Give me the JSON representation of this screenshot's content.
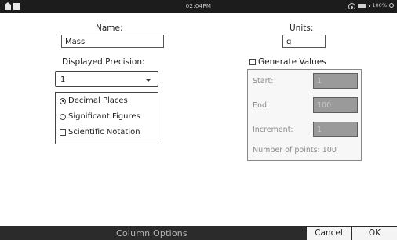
{
  "status": {
    "time": "02:04PM",
    "battery": "100%"
  },
  "name": {
    "label": "Name:",
    "value": "Mass"
  },
  "units": {
    "label": "Units:",
    "value": "g"
  },
  "precision": {
    "label": "Displayed Precision:",
    "value": "1",
    "options": [
      {
        "label": "Decimal Places",
        "selected": true
      },
      {
        "label": "Significant Figures",
        "selected": false
      }
    ],
    "scientific": {
      "label": "Scientific Notation",
      "checked": false
    }
  },
  "generate": {
    "label": "Generate Values",
    "checked": false,
    "start_label": "Start:",
    "start_value": "1",
    "end_label": "End:",
    "end_value": "100",
    "increment_label": "Increment:",
    "increment_value": "1",
    "count_text": "Number of points: 100"
  },
  "footer": {
    "title": "Column Options",
    "cancel": "Cancel",
    "ok": "OK"
  }
}
